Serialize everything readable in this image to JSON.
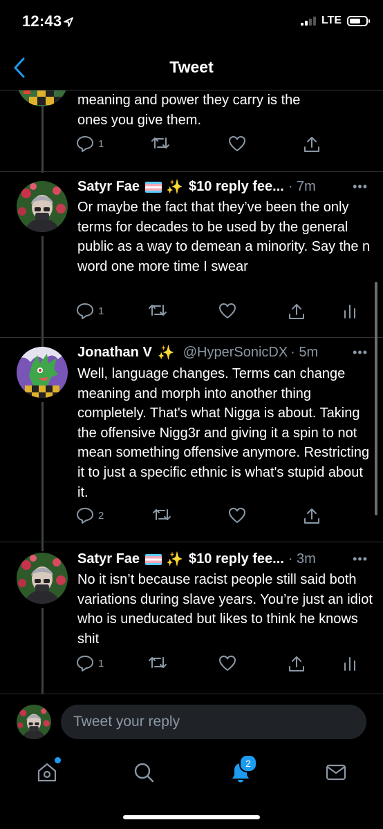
{
  "status_bar": {
    "time": "12:43",
    "network": "LTE"
  },
  "header": {
    "title": "Tweet",
    "back_icon": "chevron-left-icon"
  },
  "colors": {
    "accent": "#1d9bf0",
    "muted": "#8b98a5",
    "background": "#000000"
  },
  "top_tweet": {
    "text_lines": [
      "meaning and power they carry is the",
      "ones you give them."
    ],
    "reply_count": "1"
  },
  "tweets": [
    {
      "name": "Satyr Fae",
      "suffix": "$10 reply fee...",
      "time": "· 7m",
      "text": "Or maybe the fact that they’ve been the only terms for decades to be used by the general public as a way to demean a minority. Say the n word one more time I swear",
      "reply_count": "1"
    },
    {
      "name": "Jonathan V",
      "handle": "@HyperSonicDX",
      "time": "· 5m",
      "text": "Well, language changes. Terms can change meaning and morph into another thing completely. That's what Nigga is about. Taking the offensive Nigg3r and giving it a spin to not mean something offensive anymore. Restricting it to just a specific ethnic is what's stupid about it.",
      "reply_count": "2"
    },
    {
      "name": "Satyr Fae",
      "suffix": "$10 reply fee...",
      "time": "· 3m",
      "text": "No it isn’t because racist people still said both variations during slave years. You’re just an idiot who is uneducated but likes to think he knows shit",
      "reply_count": "1"
    }
  ],
  "reply": {
    "placeholder": "Tweet your reply"
  },
  "tab_bar": {
    "notifications_badge": "2"
  }
}
